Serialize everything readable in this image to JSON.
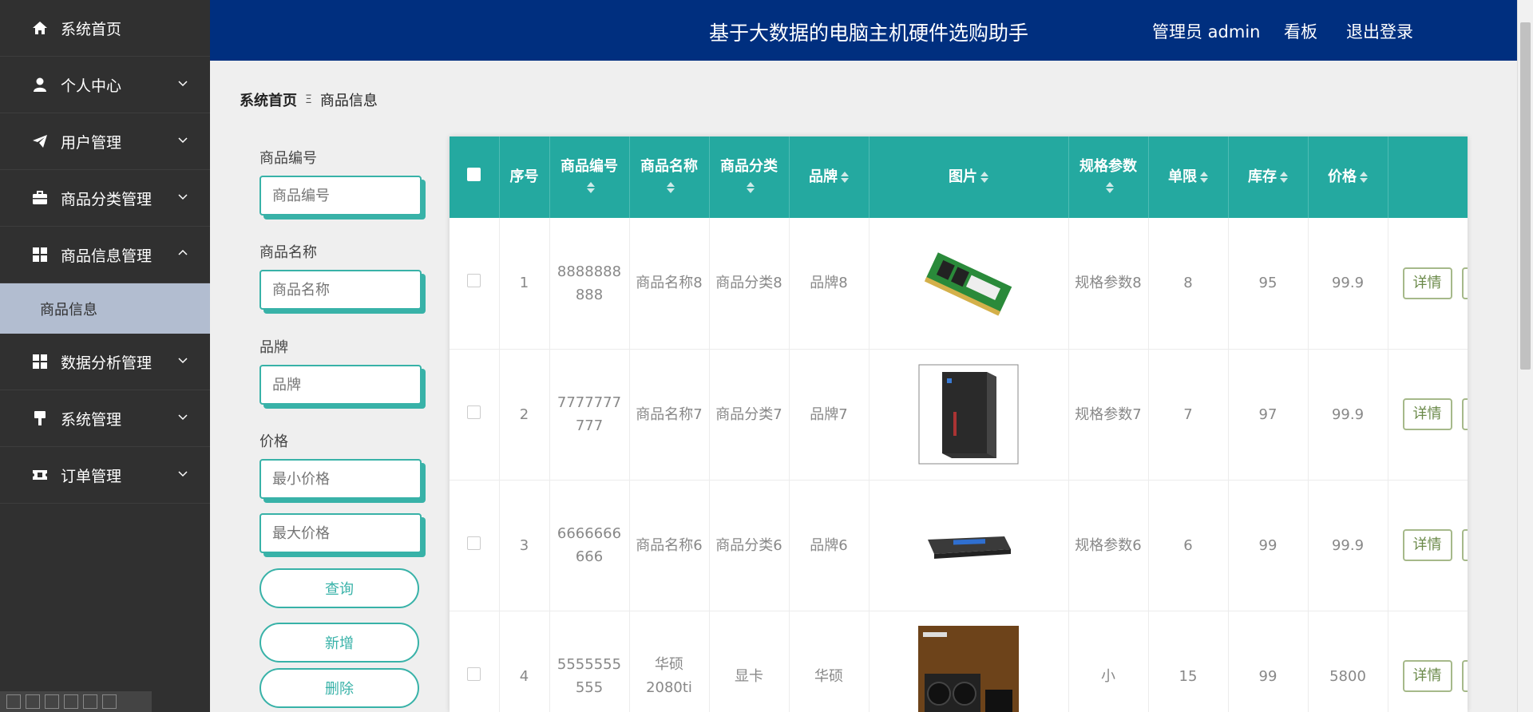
{
  "sidebar": {
    "items": [
      {
        "label": "系统首页",
        "icon": "home-icon",
        "chevron": ""
      },
      {
        "label": "个人中心",
        "icon": "user-icon",
        "chevron": "down"
      },
      {
        "label": "用户管理",
        "icon": "paper-plane-icon",
        "chevron": "down"
      },
      {
        "label": "商品分类管理",
        "icon": "briefcase-icon",
        "chevron": "down"
      },
      {
        "label": "商品信息管理",
        "icon": "grid-icon",
        "chevron": "up"
      },
      {
        "label": "数据分析管理",
        "icon": "grid-icon",
        "chevron": "down"
      },
      {
        "label": "系统管理",
        "icon": "tools-icon",
        "chevron": "down"
      },
      {
        "label": "订单管理",
        "icon": "ticket-icon",
        "chevron": "down"
      }
    ],
    "submenu": {
      "label": "商品信息"
    }
  },
  "header": {
    "title": "基于大数据的电脑主机硬件选购助手",
    "admin": "管理员 admin",
    "board": "看板",
    "logout": "退出登录"
  },
  "breadcrumb": {
    "home": "系统首页",
    "separator": "Ξ",
    "current": "商品信息"
  },
  "filters": {
    "code_label": "商品编号",
    "code_placeholder": "商品编号",
    "name_label": "商品名称",
    "name_placeholder": "商品名称",
    "brand_label": "品牌",
    "brand_placeholder": "品牌",
    "price_label": "价格",
    "min_placeholder": "最小价格",
    "max_placeholder": "最大价格",
    "query_btn": "查询",
    "add_btn": "新增",
    "delete_btn": "删除"
  },
  "table": {
    "headers": {
      "index": "序号",
      "code": "商品编号",
      "name": "商品名称",
      "category": "商品分类",
      "brand": "品牌",
      "image": "图片",
      "spec": "规格参数",
      "limit": "单限",
      "stock": "库存",
      "price": "价格"
    },
    "detail_label": "详情",
    "rows": [
      {
        "index": "1",
        "code": "8888888888",
        "name": "商品名称8",
        "category": "商品分类8",
        "brand": "品牌8",
        "image": "ram-module",
        "spec": "规格参数8",
        "limit": "8",
        "stock": "95",
        "price": "99.9"
      },
      {
        "index": "2",
        "code": "7777777777",
        "name": "商品名称7",
        "category": "商品分类7",
        "brand": "品牌7",
        "image": "pc-case",
        "spec": "规格参数7",
        "limit": "7",
        "stock": "97",
        "price": "99.9"
      },
      {
        "index": "3",
        "code": "6666666666",
        "name": "商品名称6",
        "category": "商品分类6",
        "brand": "品牌6",
        "image": "ssd-drive",
        "spec": "规格参数6",
        "limit": "6",
        "stock": "99",
        "price": "99.9"
      },
      {
        "index": "4",
        "code": "5555555555",
        "name": "华硕2080ti",
        "category": "显卡",
        "brand": "华硕",
        "image": "graphics-card-box",
        "spec": "小",
        "limit": "15",
        "stock": "99",
        "price": "5800"
      }
    ]
  },
  "colors": {
    "sidebar": "#303030",
    "header": "#002f7f",
    "accent": "#24a9a0",
    "submenu_active": "#b2bdd0"
  }
}
